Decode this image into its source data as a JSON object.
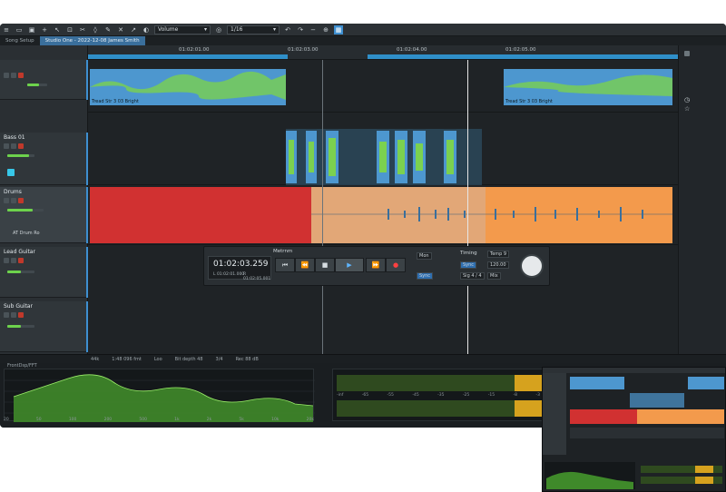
{
  "toolbar": {
    "volume_label": "Volume",
    "quantize_label": "1/16"
  },
  "tabs": [
    {
      "label": "Song Setup"
    },
    {
      "label": "Studio One - 2022-12-08 James Smith"
    }
  ],
  "ruler": {
    "markers": [
      "01:02:01.00",
      "01:02:03.00",
      "01:02:04.00",
      "01:02:05.00"
    ]
  },
  "tracks": [
    {
      "name": ""
    },
    {
      "name": "Bass 01"
    },
    {
      "name": "Drums",
      "insert": "AT Drum Ro"
    },
    {
      "name": "Lead Guitar"
    },
    {
      "name": "Sub Guitar"
    }
  ],
  "clips": {
    "top_left_label": "Tread Str 3 03 Bright",
    "top_right_label": "Tread Str 3 03 Bright"
  },
  "transport": {
    "time_main": "01:02:03.259",
    "time_sub_l": "L 01:02:01.000",
    "time_sub_r": "R 01:02:05.001",
    "metronome_label": "Metrnm",
    "timing_label": "Timing",
    "sync_label": "Sync",
    "tempo_value": "120.00",
    "sig_value": "4 / 4",
    "monitor_label": "Mon",
    "tempo_label": "Temp",
    "tempo_num": "9",
    "mix_label": "Mix",
    "sync2_label": "Sync",
    "sig_label": "Sig"
  },
  "status": {
    "items": [
      "44k",
      "1:48 096 fmt",
      "Loo",
      "Bit depth 48",
      "3/4",
      "Rec 88 dB"
    ]
  },
  "bottom": {
    "spec_title": "FrontDsp/FFT",
    "freq_ticks": [
      "20",
      "50",
      "100",
      "200",
      "500",
      "1k",
      "2k",
      "5k",
      "10k",
      "20k"
    ],
    "db_ticks": [
      "-12",
      "-18",
      "-24",
      "-30",
      "-36",
      "-42",
      "-48",
      "-54",
      "-60",
      "-66"
    ],
    "meter_ticks": [
      "-inf",
      "-65",
      "-55",
      "-45",
      "-35",
      "-25",
      "-15",
      "-8",
      "-3"
    ]
  },
  "colors": {
    "accent": "#3e8fd0",
    "clip_blue": "#4d97cf",
    "clip_green": "#7bd14f",
    "drums_red": "#d13131",
    "drums_orange": "#f39a4c",
    "meter_yellow": "#d6a21e"
  }
}
